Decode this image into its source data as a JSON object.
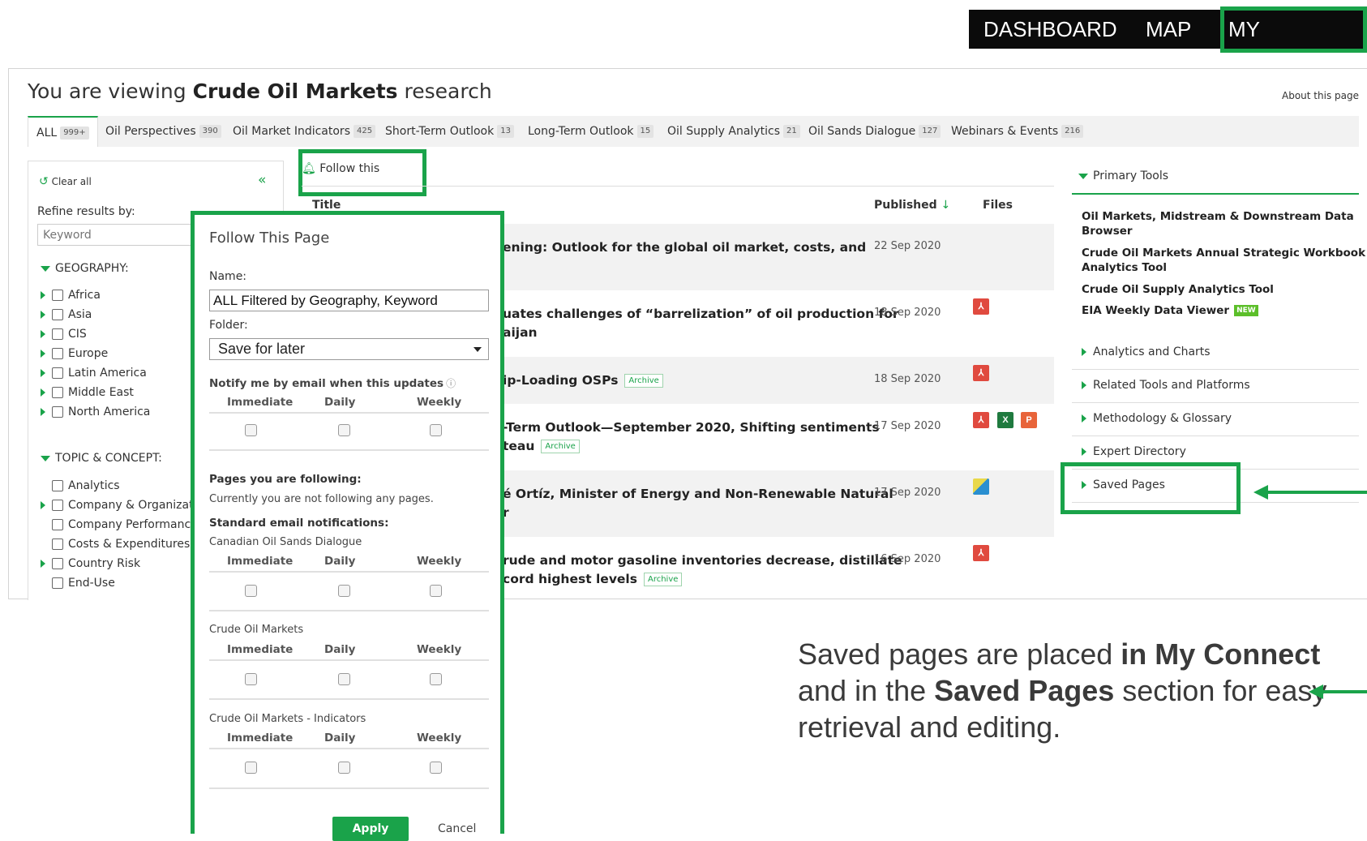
{
  "topnav": {
    "dashboard": "DASHBOARD",
    "map": "MAP",
    "my_connect": "MY CONNECT"
  },
  "header": {
    "prefix": "You are viewing",
    "subject": "Crude Oil Markets",
    "suffix": "research",
    "about": "About this page"
  },
  "tabs": [
    {
      "label": "ALL",
      "count": "999+"
    },
    {
      "label": "Oil Perspectives",
      "count": "390"
    },
    {
      "label": "Oil Market Indicators",
      "count": "425"
    },
    {
      "label": "Short-Term Outlook",
      "count": "13"
    },
    {
      "label": "Long-Term Outlook",
      "count": "15"
    },
    {
      "label": "Oil Supply Analytics",
      "count": "21"
    },
    {
      "label": "Oil Sands Dialogue",
      "count": "127"
    },
    {
      "label": "Webinars & Events",
      "count": "216"
    }
  ],
  "filters": {
    "clear_all": "Clear all",
    "collapse": "«",
    "refine_label": "Refine results by:",
    "keyword_placeholder": "Keyword",
    "geography_heading": "GEOGRAPHY:",
    "geography": [
      "Africa",
      "Asia",
      "CIS",
      "Europe",
      "Latin America",
      "Middle East",
      "North America"
    ],
    "topic_heading": "TOPIC & CONCEPT:",
    "topics": [
      "Analytics",
      "Company & Organizat",
      "Company Performanc",
      "Costs & Expenditures",
      "Country Risk",
      "End-Use"
    ]
  },
  "follow": {
    "label": "Follow this"
  },
  "results": {
    "col_title": "Title",
    "col_published": "Published",
    "col_files": "Files",
    "rows": [
      {
        "title_line1": "ening: Outlook for the global oil market, costs, and",
        "title_line2": "",
        "date": "22 Sep 2020"
      },
      {
        "title_line1": "uates challenges of “barrelization” of oil production for",
        "title_line2": "aijan",
        "date": "18 Sep 2020"
      },
      {
        "title_line1": "ip-Loading OSPs",
        "title_line2": "",
        "date": "18 Sep 2020"
      },
      {
        "title_line1": "-Term Outlook—September 2020, Shifting sentiments",
        "title_line2": "teau",
        "date": "17 Sep 2020"
      },
      {
        "title_line1": "é Ortíz, Minister of Energy and Non-Renewable Natural",
        "title_line2": "r",
        "date": "17 Sep 2020"
      },
      {
        "title_line1": "rude and motor gasoline inventories decrease, distillate",
        "title_line2": "cord highest levels",
        "date": "16 Sep 2020"
      }
    ],
    "archive_label": "Archive",
    "icon_x": "X",
    "icon_p": "P"
  },
  "modal": {
    "title": "Follow This Page",
    "name_label": "Name:",
    "name_value": "ALL Filtered by Geography, Keyword",
    "folder_label": "Folder:",
    "folder_value": "Save for later",
    "notify_label": "Notify me by email when this updates",
    "info_glyph": "ⓘ",
    "freq": [
      "Immediate",
      "Daily",
      "Weekly"
    ],
    "following_heading": "Pages you are following:",
    "following_text": "Currently you are not following any pages.",
    "standard_heading": "Standard email notifications:",
    "groups": [
      "Canadian Oil Sands Dialogue",
      "Crude Oil Markets",
      "Crude Oil Markets - Indicators"
    ],
    "apply": "Apply",
    "cancel": "Cancel"
  },
  "right_tools": {
    "primary_heading": "Primary Tools",
    "primary_links": [
      "Oil Markets, Midstream & Downstream Data",
      "Browser",
      "Crude Oil Markets Annual Strategic Workbook",
      "Analytics Tool",
      "Crude Oil Supply Analytics Tool",
      "EIA Weekly Data Viewer"
    ],
    "new_badge": "NEW",
    "sections": [
      "Analytics and Charts",
      "Related Tools and Platforms",
      "Methodology & Glossary",
      "Expert Directory",
      "Saved Pages"
    ]
  },
  "annotation": {
    "p1": "Saved pages are placed ",
    "b1": "in My Connect",
    "p2": " and in the ",
    "b2": "Saved Pages",
    "p3": " section for easy retrieval and editing."
  },
  "colors": {
    "accent": "#1aa34a",
    "nav_bg": "#0b0b0b"
  }
}
